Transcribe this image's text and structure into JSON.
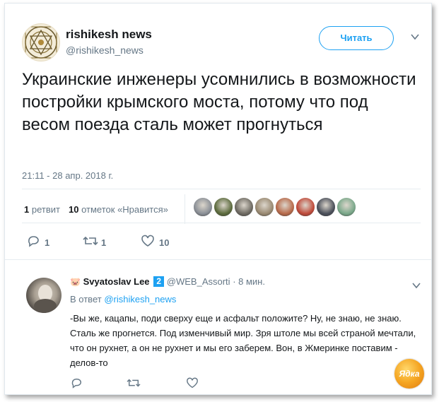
{
  "tweet": {
    "author_name": "rishikesh news",
    "author_handle": "@rishikesh_news",
    "follow_label": "Читать",
    "text": "Украинские инженеры усомнились в возможности постройки крымского моста, потому что под весом поезда сталь может прогнуться",
    "timestamp": "21:11 - 28 апр. 2018 г.",
    "retweets_count": "1",
    "retweets_label": "ретвит",
    "likes_count": "10",
    "likes_label": "отметок «Нравится»",
    "reply_count": "1",
    "retweet_count_action": "1",
    "like_count_action": "10"
  },
  "likers": [
    {
      "color": "#8a8f96"
    },
    {
      "color": "#5c6b3d"
    },
    {
      "color": "#6e6a62"
    },
    {
      "color": "#9a8a72"
    },
    {
      "color": "#b86a4a"
    },
    {
      "color": "#c04a3a"
    },
    {
      "color": "#4a4f5a"
    },
    {
      "color": "#7aa88a"
    }
  ],
  "reply": {
    "author_name": "Svyatoslav Lee",
    "badge": "2",
    "author_handle": "@WEB_Assorti",
    "time": "· 8 мин.",
    "in_reply_prefix": "В ответ",
    "in_reply_handle": "@rishikesh_news",
    "text": "-Вы же, кацапы, поди сверху еще и асфальт положите? Ну, не знаю, не знаю. Сталь же прогнется. Под изменчивый мир. Зря штоле мы всей страной мечтали, что он рухнет, а он не рухнет и мы его заберем. Вон, в Жмеринке поставим - делов-то"
  },
  "watermark": {
    "text": "Ядка"
  },
  "colors": {
    "accent": "#1da1f2",
    "muted": "#657786",
    "text": "#14171a"
  }
}
